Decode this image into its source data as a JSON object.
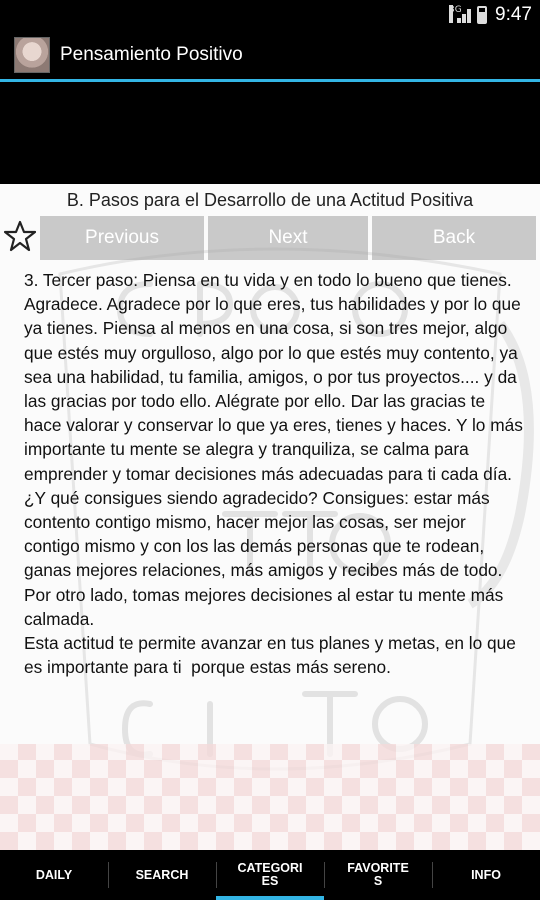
{
  "status_bar": {
    "time": "9:47",
    "network": "3G"
  },
  "app": {
    "title": "Pensamiento Positivo"
  },
  "section": {
    "title": "B. Pasos para el Desarrollo de una Actitud Positiva"
  },
  "nav": {
    "previous": "Previous",
    "next": "Next",
    "back": "Back"
  },
  "body_text": "3. Tercer paso: Piensa en tu vida y en todo lo bueno que tienes. Agradece. Agradece por lo que eres, tus habilidades y por lo que ya tienes. Piensa al menos en una cosa, si son tres mejor, algo que estés muy orgulloso, algo por lo que estés muy contento, ya sea una habilidad, tu familia, amigos, o por tus proyectos.... y da las gracias por todo ello. Alégrate por ello. Dar las gracias te hace valorar y conservar lo que ya eres, tienes y haces. Y lo más importante tu mente se alegra y tranquiliza, se calma para emprender y tomar decisiones más adecuadas para ti cada día. ¿Y qué consigues siendo agradecido? Consigues: estar más contento contigo mismo, hacer mejor las cosas, ser mejor contigo mismo y con los las demás personas que te rodean, ganas mejores relaciones, más amigos y recibes más de todo. Por otro lado, tomas mejores decisiones al estar tu mente más calmada.\nEsta actitud te permite avanzar en tus planes y metas, en lo que es importante para ti  porque estas más sereno.",
  "tabs": [
    {
      "label": "DAILY",
      "active": false
    },
    {
      "label": "SEARCH",
      "active": false
    },
    {
      "label": "CATEGORIES",
      "active": true
    },
    {
      "label": "FAVORITES",
      "active": false
    },
    {
      "label": "INFO",
      "active": false
    }
  ],
  "colors": {
    "accent": "#33b5e5",
    "bar": "#000000",
    "content_bg": "#fbfbfb"
  },
  "icons": {
    "favorite": "star-outline-icon"
  }
}
